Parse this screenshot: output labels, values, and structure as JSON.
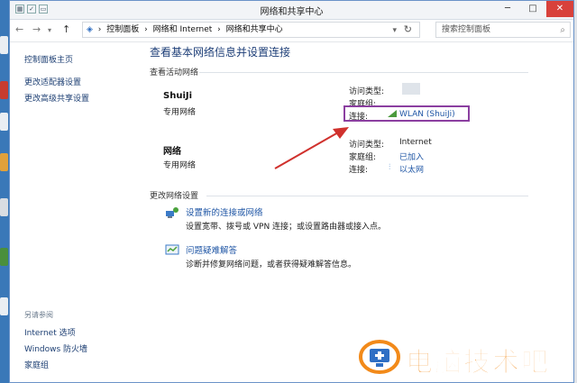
{
  "window": {
    "title": "网络和共享中心",
    "controls": {
      "minimize": "─",
      "maximize": "□",
      "close": "✕"
    }
  },
  "nav": {
    "back": "←",
    "forward": "→",
    "up": "↑",
    "breadcrumb": [
      "控制面板",
      "网络和 Internet",
      "网络和共享中心"
    ],
    "search_placeholder": "搜索控制面板"
  },
  "left_pane": {
    "home": "控制面板主页",
    "links": [
      "更改适配器设置",
      "更改高级共享设置"
    ],
    "see_also_title": "另请参阅",
    "see_also": [
      "Internet 选项",
      "Windows 防火墙",
      "家庭组"
    ]
  },
  "main": {
    "title": "查看基本网络信息并设置连接",
    "active_networks_title": "查看活动网络",
    "networks": [
      {
        "name": "ShuiJi",
        "type": "专用网络",
        "access_type_label": "访问类型:",
        "access_type_value": "",
        "homegroup_label": "家庭组:",
        "homegroup_value": "",
        "connection_label": "连接:",
        "connection_value": "WLAN (ShuiJi)"
      },
      {
        "name": "网络",
        "type": "专用网络",
        "access_type_label": "访问类型:",
        "access_type_value": "Internet",
        "homegroup_label": "家庭组:",
        "homegroup_value": "已加入",
        "connection_label": "连接:",
        "connection_value": "以太网"
      }
    ],
    "change_settings_title": "更改网络设置",
    "tasks": [
      {
        "title": "设置新的连接或网络",
        "desc": "设置宽带、拨号或 VPN 连接；或设置路由器或接入点。"
      },
      {
        "title": "问题疑难解答",
        "desc": "诊断并修复网络问题，或者获得疑难解答信息。"
      }
    ]
  },
  "watermark": {
    "text": "电脑技术吧"
  },
  "colors": {
    "highlight_box": "#8b3fa0",
    "arrow": "#d0312d",
    "link": "#1f56a5",
    "watermark": "#f28a1a"
  }
}
